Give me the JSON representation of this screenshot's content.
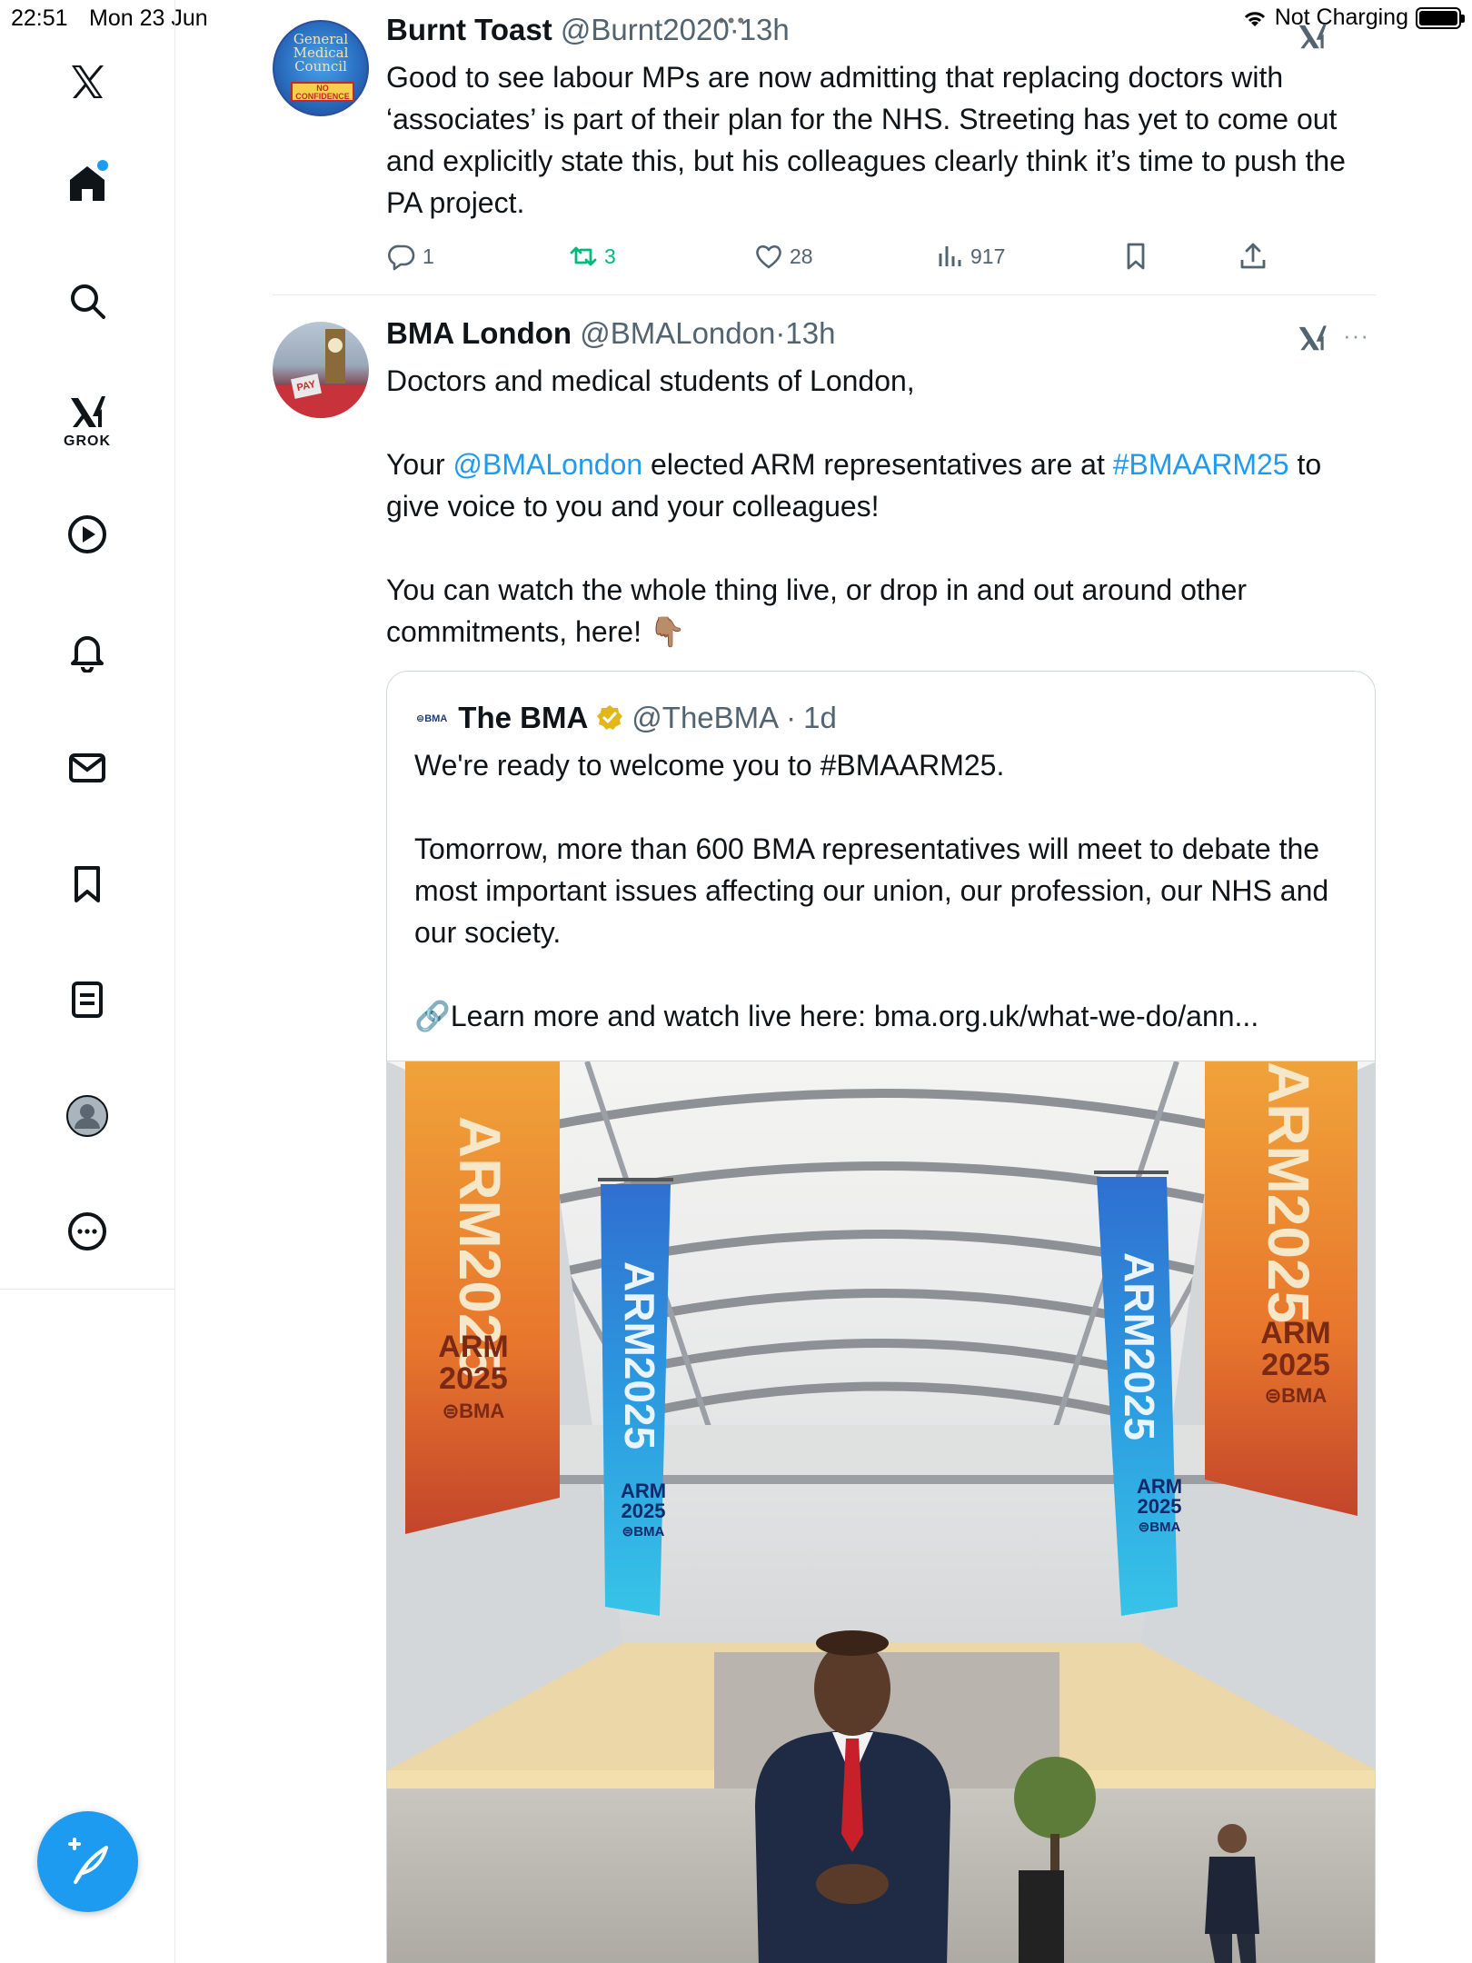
{
  "status_bar": {
    "time": "22:51",
    "date": "Mon 23 Jun",
    "charging": "Not Charging"
  },
  "sidebar": {
    "items": [
      {
        "name": "x-logo-icon"
      },
      {
        "name": "home-icon"
      },
      {
        "name": "search-icon"
      },
      {
        "name": "grok-icon",
        "label": "GROK"
      },
      {
        "name": "video-play-icon"
      },
      {
        "name": "notifications-bell-icon"
      },
      {
        "name": "messages-envelope-icon"
      },
      {
        "name": "bookmarks-icon"
      },
      {
        "name": "lists-icon"
      },
      {
        "name": "profile-avatar-icon"
      },
      {
        "name": "more-options-icon"
      }
    ],
    "compose_icon": "compose-feather-icon"
  },
  "posts": [
    {
      "name": "Burnt Toast",
      "handle": "@Burnt2020",
      "separator": "·",
      "time": "13h",
      "text": "Good to see labour MPs are now admitting that replacing doctors with ‘associates’ is part of their plan for the NHS. Streeting has yet to come out and explicitly state this, but his colleagues clearly think it’s time to push the PA project.",
      "avatar_text": "General Medical Council",
      "avatar_stamp": "NO CONFIDENCE",
      "actions": {
        "replies": "1",
        "reposts": "3",
        "likes": "28",
        "views": "917"
      }
    },
    {
      "name": "BMA London",
      "handle": "@BMALondon",
      "separator": "·",
      "time": "13h",
      "avatar_sign": "PAY",
      "more": "···",
      "paragraphs": {
        "p1": "Doctors and medical students of London,",
        "p2_pre": "Your ",
        "p2_mention": "@BMALondon",
        "p2_mid": " elected ARM representatives are at ",
        "p2_hashtag": "#BMAARM25",
        "p2_post": " to give voice to you and your colleagues!",
        "p3": "You can watch the whole thing live, or drop in and out around other commitments, here! 👇🏽"
      },
      "quote": {
        "logo": "⊜BMA",
        "name": "The BMA",
        "handle": "@TheBMA",
        "separator": "·",
        "time": "1d",
        "p1": "We're ready to welcome you to #BMAARM25.",
        "p2": "Tomorrow, more than 600 BMA representatives will meet to debate the most important issues affecting our union, our profession, our NHS and our society.",
        "p3": "🔗Learn more and watch live here: bma.org.uk/what-we-do/ann...",
        "image": {
          "banner_big": "ARM2025",
          "banner_year_a": "ARM",
          "banner_year_b": "2025",
          "banner_org": "⊜BMA"
        }
      }
    }
  ],
  "colors": {
    "accent": "#1d9bf0",
    "repost_green": "#00ba7c",
    "muted": "#536471",
    "text": "#0f1419",
    "verified_gold": "#e2b719"
  }
}
